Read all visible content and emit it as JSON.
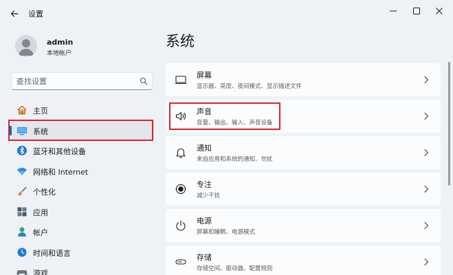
{
  "window": {
    "title": "设置",
    "controls": {
      "minimize": "minimize-icon",
      "maximize": "maximize-icon",
      "close": "close-icon"
    }
  },
  "profile": {
    "username": "admin",
    "account_type": "本地帐户"
  },
  "search": {
    "placeholder": "查找设置"
  },
  "sidebar": {
    "items": [
      {
        "label": "主页",
        "icon": "home-icon",
        "active": false
      },
      {
        "label": "系统",
        "icon": "display-icon",
        "active": true
      },
      {
        "label": "蓝牙和其他设备",
        "icon": "bluetooth-icon",
        "active": false
      },
      {
        "label": "网络和 Internet",
        "icon": "wifi-icon",
        "active": false
      },
      {
        "label": "个性化",
        "icon": "brush-icon",
        "active": false
      },
      {
        "label": "应用",
        "icon": "apps-icon",
        "active": false
      },
      {
        "label": "帐户",
        "icon": "account-icon",
        "active": false
      },
      {
        "label": "时间和语言",
        "icon": "clock-globe-icon",
        "active": false
      },
      {
        "label": "游戏",
        "icon": "gamepad-icon",
        "active": false
      }
    ]
  },
  "main": {
    "title": "系统",
    "cards": [
      {
        "title": "屏幕",
        "subtitle": "显示器、亮度、夜间模式、显示描述文件",
        "icon": "monitor-icon"
      },
      {
        "title": "声音",
        "subtitle": "音量、输出、输入、声音设备",
        "icon": "speaker-icon"
      },
      {
        "title": "通知",
        "subtitle": "来自应用和系统的通知、勿扰",
        "icon": "bell-icon"
      },
      {
        "title": "专注",
        "subtitle": "减少干扰",
        "icon": "focus-icon"
      },
      {
        "title": "电源",
        "subtitle": "屏幕和睡眠、电源模式",
        "icon": "power-icon"
      },
      {
        "title": "存储",
        "subtitle": "存储空间、驱动器、配置规则",
        "icon": "storage-icon"
      }
    ]
  },
  "colors": {
    "accent": "#0067c0",
    "highlight": "#d9232a",
    "background": "#eef2f7",
    "card": "#fbfcfd"
  }
}
